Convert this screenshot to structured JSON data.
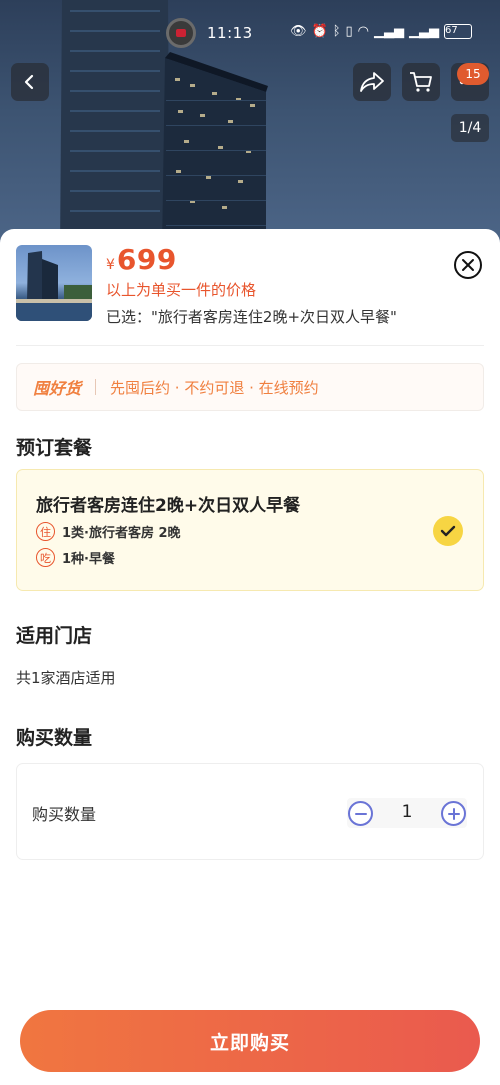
{
  "status_bar": {
    "time": "11:13",
    "battery": "67",
    "icons": [
      "eye-icon",
      "alarm-icon",
      "bluetooth-icon",
      "vibrate-icon",
      "wifi-icon",
      "5g-signal-icon",
      "5g-signal-icon"
    ]
  },
  "nav": {
    "cart_badge": "15",
    "pager": "1/4"
  },
  "product": {
    "currency": "¥",
    "price": "699",
    "price_note": "以上为单买一件的价格",
    "selected": "已选：\"旅行者客房连住2晚+次日双人早餐\""
  },
  "guarantee": {
    "logo": "囤好货",
    "text": "先囤后约 · 不约可退 · 在线预约"
  },
  "package_section": {
    "title": "预订套餐",
    "package_name": "旅行者客房连住2晚+次日双人早餐",
    "lines": [
      {
        "tag": "住",
        "text": "1类·旅行者客房 2晚"
      },
      {
        "tag": "吃",
        "text": "1种·早餐"
      }
    ]
  },
  "store_section": {
    "title": "适用门店",
    "count_text": "共1家酒店适用"
  },
  "quantity_section": {
    "title": "购买数量",
    "label": "购买数量",
    "value": "1"
  },
  "buy_button": "立即购买",
  "colors": {
    "accent": "#e8552d",
    "guarantee": "#f08040",
    "check": "#f7d543",
    "stepper": "#6a74d6",
    "button_start": "#f07640",
    "button_end": "#ea5a4e"
  }
}
